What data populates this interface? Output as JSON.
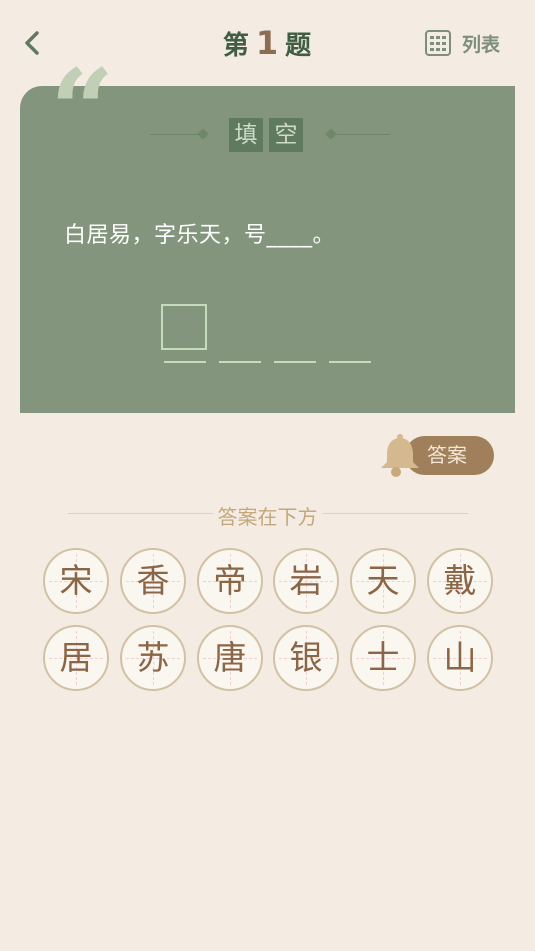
{
  "header": {
    "title_prefix": "第",
    "question_number": "1",
    "title_suffix": "题",
    "list_label": "列表"
  },
  "card": {
    "quote_glyph": "“",
    "badge": [
      "填",
      "空"
    ],
    "question_text": "白居易，字乐天，号____。",
    "answer_slots": 4
  },
  "answer_toggle": {
    "label": "答案"
  },
  "section": {
    "label": "答案在下方"
  },
  "choices": [
    "宋",
    "香",
    "帝",
    "岩",
    "天",
    "戴",
    "居",
    "苏",
    "唐",
    "银",
    "士",
    "山"
  ],
  "colors": {
    "background": "#f4ebe2",
    "card": "#83967d",
    "title_green": "#3f5e43",
    "accent_brown": "#a0805a",
    "choice_text": "#8b6646"
  },
  "icons": {
    "back": "chevron-left-icon",
    "list": "grid-list-icon",
    "answer": "bell-icon"
  }
}
